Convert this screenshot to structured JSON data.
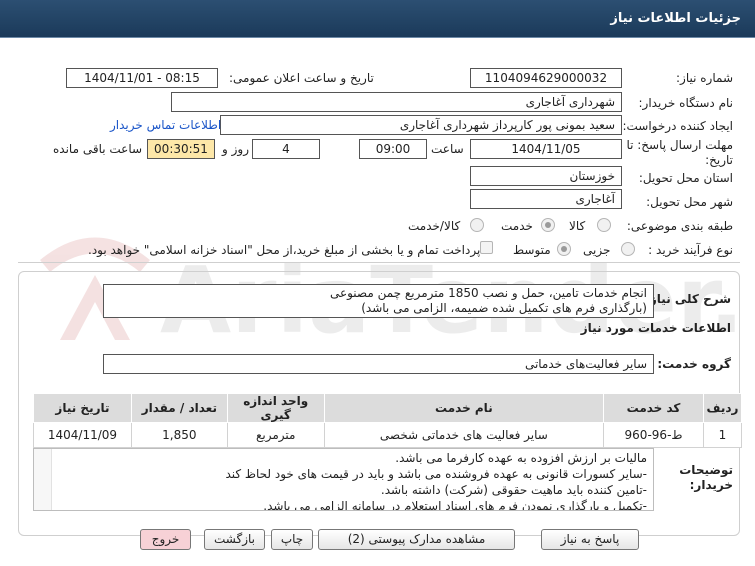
{
  "window": {
    "title": "جزئیات اطلاعات نیاز"
  },
  "form": {
    "need_number": {
      "label": "شماره نیاز:",
      "value": "1104094629000032"
    },
    "announce_datetime": {
      "label": "تاریخ و ساعت اعلان عمومی:",
      "value": "1404/11/01 - 08:15"
    },
    "buyer_org": {
      "label": "نام دستگاه خریدار:",
      "value": "شهرداری آغاجاری"
    },
    "requester": {
      "label": "ایجاد کننده درخواست:",
      "value": "سعید بمونی پور کارپرداز شهرداری آغاجاری",
      "contact_link": "اطلاعات تماس خریدار"
    },
    "deadline": {
      "label_line1": "مهلت ارسال پاسخ: تا",
      "label_line2": "تاریخ:",
      "date": "1404/11/05",
      "time_label": "ساعت",
      "time": "09:00",
      "days": "4",
      "days_label": "روز و",
      "remaining": "00:30:51",
      "remaining_label": "ساعت باقی مانده"
    },
    "province": {
      "label": "استان محل تحویل:",
      "value": "خوزستان"
    },
    "city": {
      "label": "شهر محل تحویل:",
      "value": "آغاجاری"
    },
    "category": {
      "label": "طبقه بندی موضوعی:",
      "options": [
        "کالا",
        "خدمت",
        "کالا/خدمت"
      ],
      "selected": "خدمت"
    },
    "purchase_type": {
      "label": "نوع فرآیند خرید :",
      "options": [
        "جزیی",
        "متوسط"
      ],
      "selected": "متوسط",
      "payment_note": "پرداخت تمام و یا بخشی از مبلغ خرید،از محل \"اسناد خزانه اسلامی\" خواهد بود."
    }
  },
  "description": {
    "label": "شرح کلی نیاز:",
    "line1": "انجام خدمات تامین، حمل و نصب 1850 مترمربع چمن مصنوعی",
    "line2": "(بارگذاری فرم های تکمیل شده ضمیمه، الزامی می باشد)"
  },
  "services_section": {
    "title": "اطلاعات خدمات مورد نیاز",
    "service_group_label": "گروه خدمت:",
    "service_group_value": "سایر فعالیت‌های خدماتی"
  },
  "table": {
    "headers": [
      "ردیف",
      "کد خدمت",
      "نام خدمت",
      "واحد اندازه گیری",
      "تعداد / مقدار",
      "تاریخ نیاز"
    ],
    "rows": [
      {
        "row": "1",
        "code": "ط-96-960",
        "name": "سایر فعالیت های خدماتی شخصی",
        "unit": "مترمربع",
        "qty": "1,850",
        "date": "1404/11/09"
      }
    ]
  },
  "buyer_notes": {
    "label_line1": "توضیحات",
    "label_line2": "خریدار:",
    "lines": [
      "مالیات بر ارزش افزوده به عهده کارفرما می باشد.",
      "-سایر کسورات قانونی به عهده فروشنده می باشد و باید در قیمت های خود لحاظ کند",
      "-تامین کننده باید ماهیت حقوقی (شرکت) داشته باشد.",
      "-تکمیل و بارگذاری نمودن فرم های اسناد استعلام در سامانه الزامی می باشد."
    ]
  },
  "buttons": {
    "reply": "پاسخ به نیاز",
    "attachments": "مشاهده مدارک پیوستی (2)",
    "print": "چاپ",
    "back": "بازگشت",
    "exit": "خروج"
  },
  "watermark": {
    "text": "AriaTender.net"
  },
  "colors": {
    "header_bg": "#1f3f60",
    "link": "#1a55c8",
    "highlight": "#fde7a8",
    "exit_button": "#f7d1d6"
  }
}
